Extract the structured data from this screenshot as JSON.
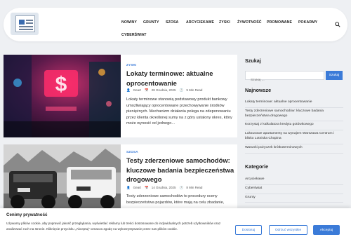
{
  "nav": {
    "items": [
      "NOWINY",
      "GRUNTY",
      "SZOSA",
      "ARCYCIEKAWE",
      "ZYSKI",
      "ŻYWOTNOŚĆ",
      "PROMOWANE",
      "POKARMY",
      "CYBERŚWIAT"
    ]
  },
  "posts": [
    {
      "tag": "ZYSKI",
      "title": "Lokaty terminowe: aktualne oprocentowanie",
      "author": "Geart",
      "date": "28 Grudnia, 2025",
      "read": "9 Min Read",
      "excerpt": "Lokaty terminowe stanowią podstawowy produkt bankowy umożliwiający oprocentowane przechowywanie środków pieniężnych. Mechanizm działania polega na zdeponowaniu przez klienta określonej sumy na z góry ustalony okres, który może wynosić od jednego..."
    },
    {
      "tag": "SZOSA",
      "title": "Testy zderzeniowe samochodów: kluczowe badania bezpieczeństwa drogowego",
      "author": "Geart",
      "date": "14 Grudnia, 2025",
      "read": "8 Min Read",
      "excerpt": "Testy zderzeniowe samochodów to procedury oceny bezpieczeństwa pojazdów, które mają na celu zbadanie,"
    }
  ],
  "sidebar": {
    "search_heading": "Szukaj",
    "search_placeholder": "Szukaj ...",
    "search_button": "Szukaj",
    "latest_heading": "Najnowsze",
    "latest": [
      "Lokaty terminowe: aktualne oprocentowanie",
      "Testy zderzeniowe samochodów: kluczowe badania bezpieczeństwa drogowego",
      "Korzystaj z kalkulatora kredytu gotówkowego",
      "Luksusowe apartamenty na wynajem Warszawa Centrum i blisko Lotniska Chopina",
      "Warunki pożyczek krótkoterminowych"
    ],
    "categories_heading": "Kategorie",
    "categories": [
      "Arcyciekawe",
      "Cyberświat",
      "Grunty"
    ]
  },
  "cookie": {
    "title": "Cenimy prywatność",
    "text": "Używamy plików cookie, aby poprawić jakość przeglądania, wyświetlać reklamy lub treści dostosowane do indywidualnych potrzeb użytkowników oraz analizować ruch na stronie. Kliknięcie przycisku „Akceptuj” oznacza zgodę na wykorzystywanie przez nas plików cookie.",
    "customize": "Dostosuj",
    "reject": "Odrzuć wszystkie",
    "accept": "Akceptuj"
  },
  "colors": {
    "accent": "#3b7bd8",
    "background": "#eef0f3"
  },
  "icons": {
    "search": "search-icon",
    "author": "user-icon",
    "date": "calendar-icon",
    "read": "clock-icon"
  }
}
